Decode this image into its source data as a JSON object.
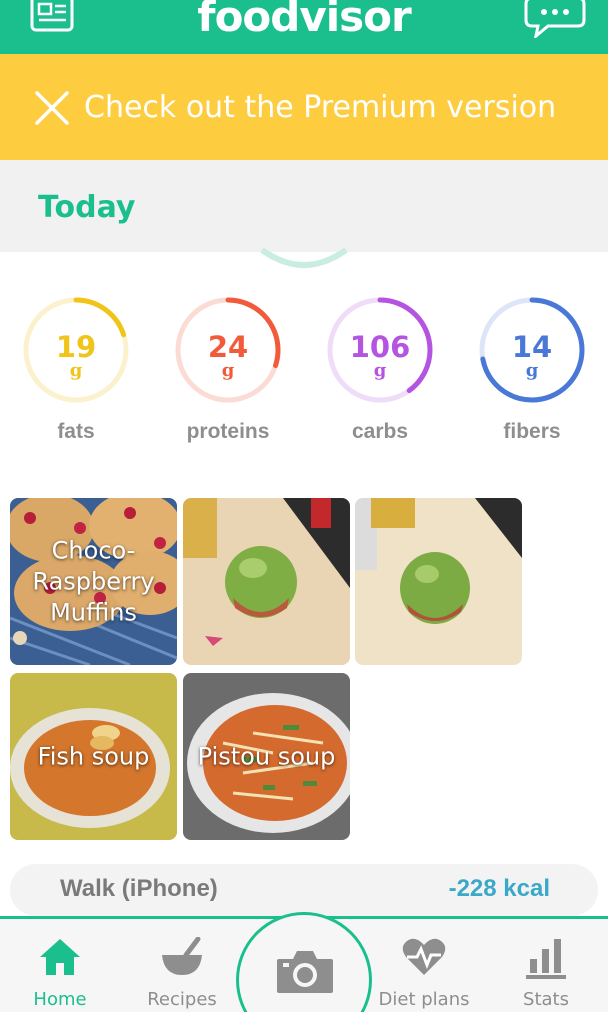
{
  "header": {
    "logo": "foodvisor"
  },
  "premium": {
    "message": "Check out the Premium version"
  },
  "day": {
    "label": "Today"
  },
  "macros": [
    {
      "value": "19",
      "unit": "g",
      "name": "fats",
      "progress": 0.2,
      "color": "#f0c419",
      "track": "#fbf1cc"
    },
    {
      "value": "24",
      "unit": "g",
      "name": "proteins",
      "progress": 0.3,
      "color": "#f15a3a",
      "track": "#fbdcd5"
    },
    {
      "value": "106",
      "unit": "g",
      "name": "carbs",
      "progress": 0.4,
      "color": "#b454e0",
      "track": "#efdcf9"
    },
    {
      "value": "14",
      "unit": "g",
      "name": "fibers",
      "progress": 0.72,
      "color": "#4a78d6",
      "track": "#dde6f8"
    }
  ],
  "meals": [
    {
      "label": "Choco-\nRaspberry\nMuffins"
    },
    {
      "label": ""
    },
    {
      "label": ""
    },
    {
      "label": "Fish soup"
    },
    {
      "label": "Pistou soup"
    }
  ],
  "activity": {
    "name": "Walk (iPhone)",
    "kcal": "-228 kcal"
  },
  "nav": {
    "home": "Home",
    "recipes": "Recipes",
    "diet_plans": "Diet plans",
    "stats": "Stats"
  },
  "colors": {
    "brand": "#1bbf8e",
    "banner": "#fdcd3f",
    "kcal": "#3aa8c9"
  }
}
